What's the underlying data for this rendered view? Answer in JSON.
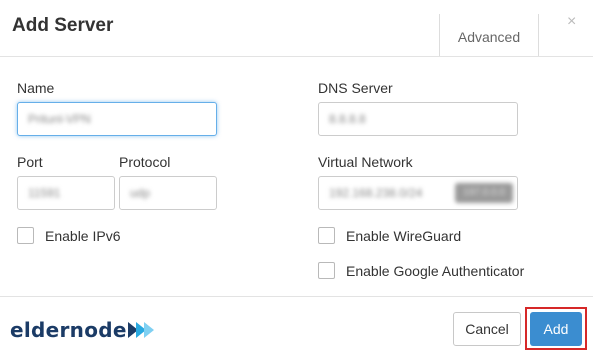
{
  "dialog": {
    "title": "Add Server",
    "tab_advanced": "Advanced",
    "close_symbol": "×"
  },
  "form": {
    "name": {
      "label": "Name",
      "value": "Pritunl-VPN"
    },
    "dns": {
      "label": "DNS Server",
      "value": "8.8.8.8"
    },
    "port": {
      "label": "Port",
      "value": "11591"
    },
    "protocol": {
      "label": "Protocol",
      "value": "udp"
    },
    "virtual_network": {
      "label": "Virtual Network",
      "value": "192.168.238.0/24",
      "chip": "197.0.0.0"
    },
    "enable_ipv6": {
      "label": "Enable IPv6",
      "checked": false
    },
    "enable_wireguard": {
      "label": "Enable WireGuard",
      "checked": false
    },
    "enable_google_auth": {
      "label": "Enable Google Authenticator",
      "checked": false
    }
  },
  "footer": {
    "logo_text": "eldernode",
    "cancel_label": "Cancel",
    "add_label": "Add"
  },
  "colors": {
    "primary": "#3b8dd0",
    "highlight_outline": "#d62828",
    "logo_dark": "#1b3b66",
    "logo_accent": "#29a9e0"
  }
}
